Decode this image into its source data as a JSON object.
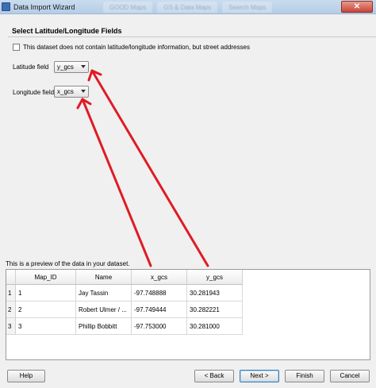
{
  "window": {
    "title": "Data Import Wizard",
    "close_glyph": "✕",
    "background_tabs": [
      "GOOD Maps",
      "GS & Data Maps",
      "Search Maps"
    ]
  },
  "section": {
    "heading": "Select Latitude/Longitude Fields"
  },
  "street_checkbox": {
    "label": "This dataset does not contain latitude/longitude information, but street addresses",
    "checked": false
  },
  "latitude": {
    "label": "Latitude field",
    "value": "y_gcs"
  },
  "longitude": {
    "label": "Longitude field",
    "value": "x_gcs"
  },
  "annotation": {
    "arrow_color": "#e01b24"
  },
  "preview": {
    "label": "This is a preview of the data in your dataset.",
    "columns": [
      "Map_ID",
      "Name",
      "x_gcs",
      "y_gcs"
    ],
    "rows": [
      {
        "num": "1",
        "map_id": "1",
        "name": "Jay Tassin",
        "x": "-97.748888",
        "y": "30.281943"
      },
      {
        "num": "2",
        "map_id": "2",
        "name": "Robert Ulmer / ...",
        "x": "-97.749444",
        "y": "30.282221"
      },
      {
        "num": "3",
        "map_id": "3",
        "name": "Phillip Bobbitt",
        "x": "-97.753000",
        "y": "30.281000"
      }
    ]
  },
  "buttons": {
    "help": "Help",
    "back": "< Back",
    "next": "Next >",
    "finish": "Finish",
    "cancel": "Cancel"
  }
}
